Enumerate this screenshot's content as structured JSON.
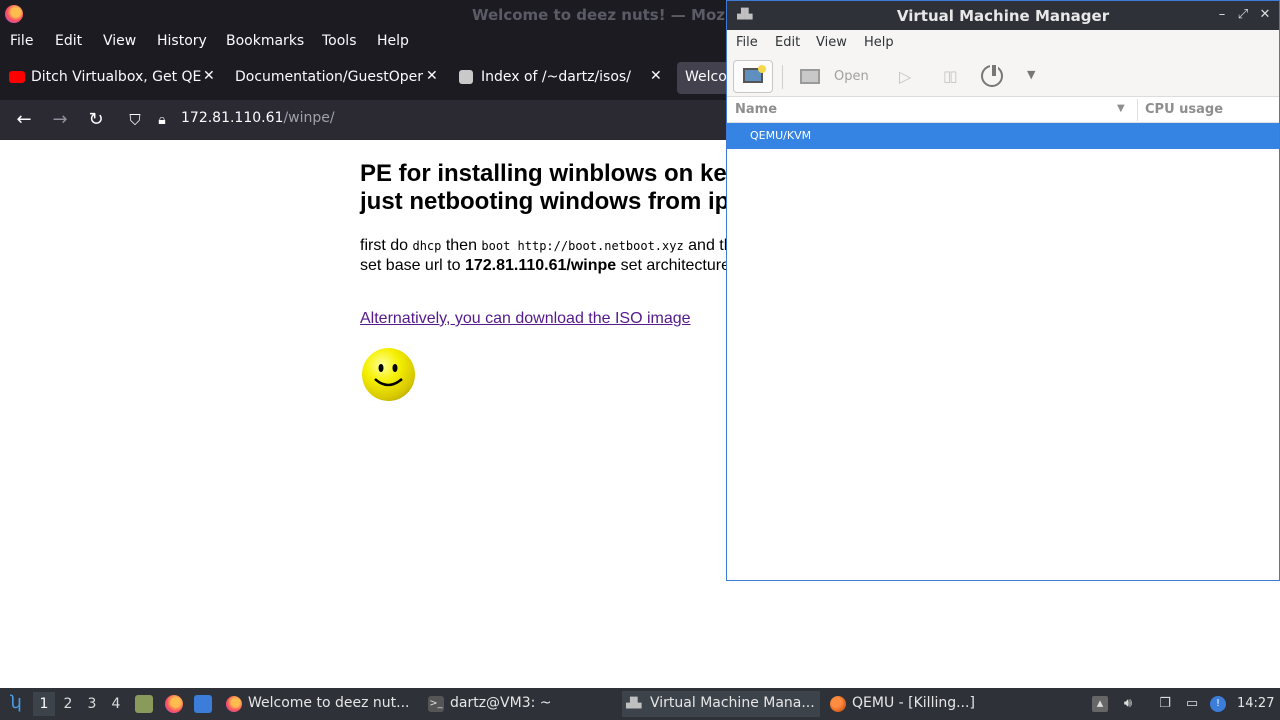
{
  "firefox": {
    "window_title": "Welcome to deez nuts! — Mozi",
    "menu": [
      "File",
      "Edit",
      "View",
      "History",
      "Bookmarks",
      "Tools",
      "Help"
    ],
    "tabs": [
      {
        "label": "Ditch Virtualbox, Get QEM"
      },
      {
        "label": "Documentation/GuestOpera"
      },
      {
        "label": "Index of /~dartz/isos/"
      },
      {
        "label": "Welco"
      }
    ],
    "url": {
      "host": "172.81.110.61",
      "path": "/winpe/"
    },
    "page": {
      "heading_line1": "PE for installing winblows on ke",
      "heading_line2": "just netbooting windows from ip",
      "p_first_do": "first do ",
      "p_cmd_dhcp": "dhcp",
      "p_then": " then ",
      "p_cmd_boot": "boot http://boot.netboot.xyz",
      "p_and": " and th",
      "p_set_base": "set base url to ",
      "p_base_url": "172.81.110.61/winpe",
      "p_set_arch": " set architecture",
      "iso_link": "Alternatively, you can download the ISO image"
    }
  },
  "vmm": {
    "title": "Virtual Machine Manager",
    "menu": [
      "File",
      "Edit",
      "View",
      "Help"
    ],
    "toolbar": {
      "open_label": "Open"
    },
    "columns": {
      "name": "Name",
      "cpu": "CPU usage"
    },
    "rows": [
      {
        "label": "QEMU/KVM"
      }
    ]
  },
  "taskbar": {
    "workspaces": [
      "1",
      "2",
      "3",
      "4"
    ],
    "tasks": [
      {
        "label": "Welcome to deez nut..."
      },
      {
        "label": "dartz@VM3: ~"
      },
      {
        "label": "Virtual Machine Mana..."
      },
      {
        "label": "QEMU - [Killing...]"
      }
    ],
    "clock": "14:27"
  },
  "colors": {
    "selection": "#3584e4",
    "visited_link": "#551a8b",
    "taskbar_bg": "#2e3238"
  }
}
